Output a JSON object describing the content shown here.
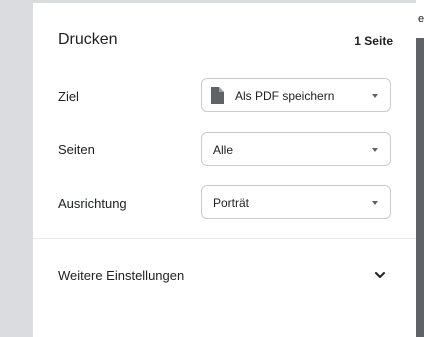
{
  "background": {
    "peek_text": "e"
  },
  "dialog": {
    "title": "Drucken",
    "page_count": "1 Seite",
    "destination": {
      "label": "Ziel",
      "value": "Als PDF speichern",
      "icon": "document-icon"
    },
    "pages": {
      "label": "Seiten",
      "value": "Alle"
    },
    "orientation": {
      "label": "Ausrichtung",
      "value": "Porträt"
    },
    "more_settings": {
      "label": "Weitere Einstellungen",
      "icon": "chevron-down-icon"
    }
  },
  "colors": {
    "panel": "#ffffff",
    "backdrop": "#dadce0",
    "border": "#c8cbd0",
    "icon": "#5f6368"
  }
}
